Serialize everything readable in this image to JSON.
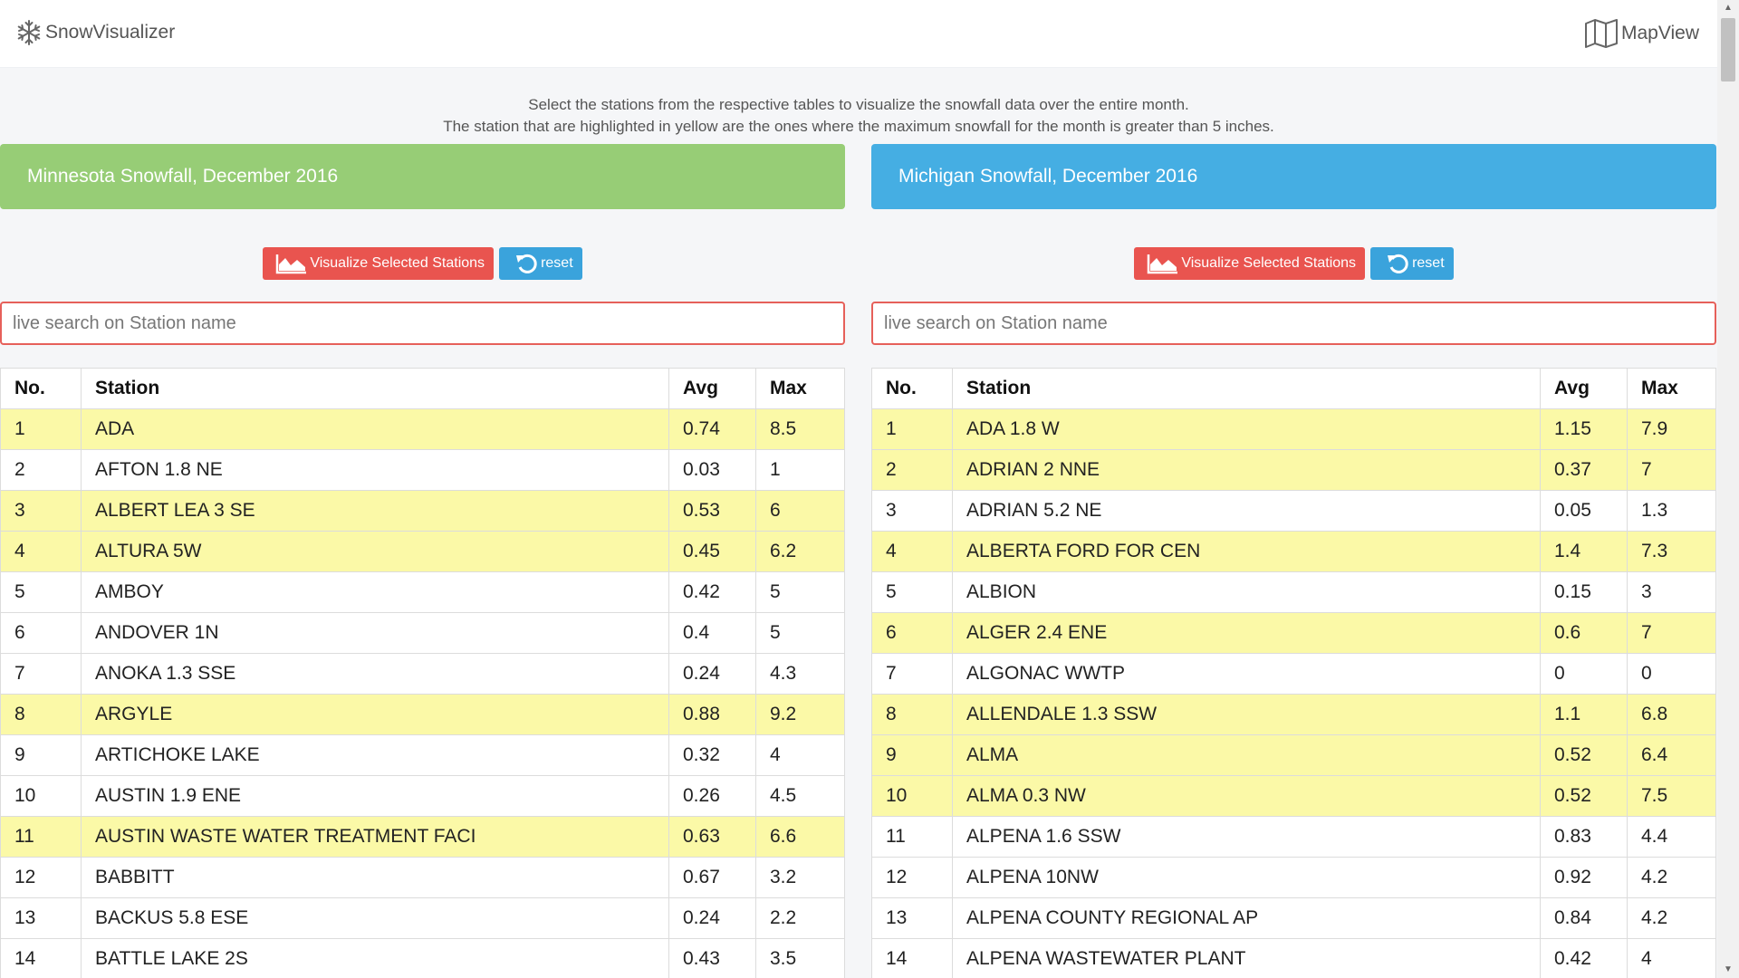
{
  "navbar": {
    "brand_label": "SnowVisualizer",
    "brand_icon": "snowflake-icon",
    "mapview_label": "MapView",
    "mapview_icon": "map-icon"
  },
  "intro": {
    "line1": "Select the stations from the respective tables to visualize the snowfall data over the entire month.",
    "line2": "The station that are highlighted in yellow are the ones where the maximum snowfall for the month is greater than 5 inches."
  },
  "colors": {
    "green_header": "#97cd76",
    "blue_header": "#45aee3",
    "highlight": "#fbf9a7",
    "viz_button": "#e9544f",
    "reset_button": "#3aa3dc"
  },
  "panels": [
    {
      "title": "Minnesota Snowfall, December 2016",
      "visualize_label": "Visualize Selected Stations",
      "reset_label": "reset",
      "search_placeholder": "live search on Station name",
      "columns": [
        "No.",
        "Station",
        "Avg",
        "Max"
      ],
      "rows": [
        {
          "no": "1",
          "station": "ADA",
          "avg": "0.74",
          "max": "8.5",
          "highlight": true
        },
        {
          "no": "2",
          "station": "AFTON 1.8 NE",
          "avg": "0.03",
          "max": "1",
          "highlight": false
        },
        {
          "no": "3",
          "station": "ALBERT LEA 3 SE",
          "avg": "0.53",
          "max": "6",
          "highlight": true
        },
        {
          "no": "4",
          "station": "ALTURA 5W",
          "avg": "0.45",
          "max": "6.2",
          "highlight": true
        },
        {
          "no": "5",
          "station": "AMBOY",
          "avg": "0.42",
          "max": "5",
          "highlight": false
        },
        {
          "no": "6",
          "station": "ANDOVER 1N",
          "avg": "0.4",
          "max": "5",
          "highlight": false
        },
        {
          "no": "7",
          "station": "ANOKA 1.3 SSE",
          "avg": "0.24",
          "max": "4.3",
          "highlight": false
        },
        {
          "no": "8",
          "station": "ARGYLE",
          "avg": "0.88",
          "max": "9.2",
          "highlight": true
        },
        {
          "no": "9",
          "station": "ARTICHOKE LAKE",
          "avg": "0.32",
          "max": "4",
          "highlight": false
        },
        {
          "no": "10",
          "station": "AUSTIN 1.9 ENE",
          "avg": "0.26",
          "max": "4.5",
          "highlight": false
        },
        {
          "no": "11",
          "station": "AUSTIN WASTE WATER TREATMENT FACI",
          "avg": "0.63",
          "max": "6.6",
          "highlight": true
        },
        {
          "no": "12",
          "station": "BABBITT",
          "avg": "0.67",
          "max": "3.2",
          "highlight": false
        },
        {
          "no": "13",
          "station": "BACKUS 5.8 ESE",
          "avg": "0.24",
          "max": "2.2",
          "highlight": false
        },
        {
          "no": "14",
          "station": "BATTLE LAKE 2S",
          "avg": "0.43",
          "max": "3.5",
          "highlight": false
        },
        {
          "no": "",
          "station": "",
          "avg": "",
          "max": "",
          "highlight": false
        }
      ]
    },
    {
      "title": "Michigan Snowfall, December 2016",
      "visualize_label": "Visualize Selected Stations",
      "reset_label": "reset",
      "search_placeholder": "live search on Station name",
      "columns": [
        "No.",
        "Station",
        "Avg",
        "Max"
      ],
      "rows": [
        {
          "no": "1",
          "station": "ADA 1.8 W",
          "avg": "1.15",
          "max": "7.9",
          "highlight": true
        },
        {
          "no": "2",
          "station": "ADRIAN 2 NNE",
          "avg": "0.37",
          "max": "7",
          "highlight": true
        },
        {
          "no": "3",
          "station": "ADRIAN 5.2 NE",
          "avg": "0.05",
          "max": "1.3",
          "highlight": false
        },
        {
          "no": "4",
          "station": "ALBERTA FORD FOR CEN",
          "avg": "1.4",
          "max": "7.3",
          "highlight": true
        },
        {
          "no": "5",
          "station": "ALBION",
          "avg": "0.15",
          "max": "3",
          "highlight": false
        },
        {
          "no": "6",
          "station": "ALGER 2.4 ENE",
          "avg": "0.6",
          "max": "7",
          "highlight": true
        },
        {
          "no": "7",
          "station": "ALGONAC WWTP",
          "avg": "0",
          "max": "0",
          "highlight": false
        },
        {
          "no": "8",
          "station": "ALLENDALE 1.3 SSW",
          "avg": "1.1",
          "max": "6.8",
          "highlight": true
        },
        {
          "no": "9",
          "station": "ALMA",
          "avg": "0.52",
          "max": "6.4",
          "highlight": true
        },
        {
          "no": "10",
          "station": "ALMA 0.3 NW",
          "avg": "0.52",
          "max": "7.5",
          "highlight": true
        },
        {
          "no": "11",
          "station": "ALPENA 1.6 SSW",
          "avg": "0.83",
          "max": "4.4",
          "highlight": false
        },
        {
          "no": "12",
          "station": "ALPENA 10NW",
          "avg": "0.92",
          "max": "4.2",
          "highlight": false
        },
        {
          "no": "13",
          "station": "ALPENA COUNTY REGIONAL AP",
          "avg": "0.84",
          "max": "4.2",
          "highlight": false
        },
        {
          "no": "14",
          "station": "ALPENA WASTEWATER PLANT",
          "avg": "0.42",
          "max": "4",
          "highlight": false
        },
        {
          "no": "",
          "station": "",
          "avg": "",
          "max": "",
          "highlight": true
        }
      ]
    }
  ]
}
